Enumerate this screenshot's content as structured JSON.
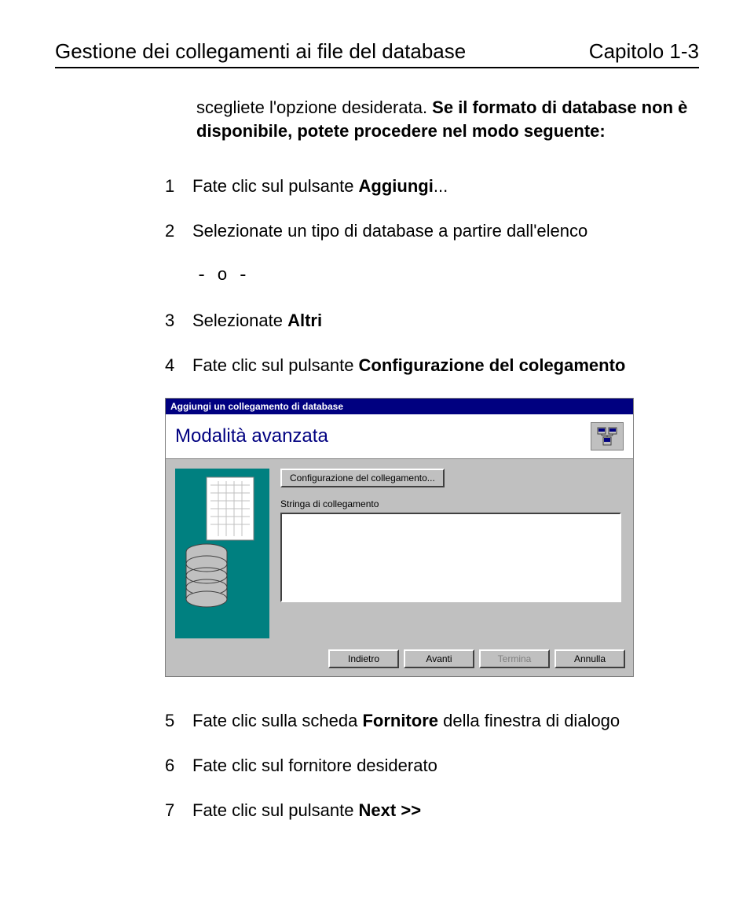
{
  "header": {
    "left": "Gestione dei collegamenti ai file del database",
    "right": "Capitolo 1-3"
  },
  "intro": {
    "pre": "scegliete l'opzione desiderata. ",
    "bold": "Se il formato di database non è disponibile, potete procedere nel modo seguente:"
  },
  "steps": {
    "s1": {
      "num": "1",
      "pre": "Fate clic sul pulsante ",
      "bold": "Aggiungi",
      "post": "..."
    },
    "or": "- o -",
    "s2": {
      "num": "2",
      "txt": "Selezionate un tipo di database a partire dall'elenco"
    },
    "s3": {
      "num": "3",
      "pre": "Selezionate ",
      "bold": "Altri"
    },
    "s4": {
      "num": "4",
      "pre": "Fate clic sul pulsante ",
      "bold": "Configurazione del colegamento"
    },
    "s5": {
      "num": "5",
      "pre": "Fate clic sulla scheda ",
      "bold": "Fornitore",
      "post": " della finestra di dialogo"
    },
    "s6": {
      "num": "6",
      "txt": "Fate clic sul fornitore desiderato"
    },
    "s7": {
      "num": "7",
      "pre": "Fate clic sul pulsante ",
      "bold": "Next >>"
    }
  },
  "dialog": {
    "title": "Aggiungi un collegamento di database",
    "banner": "Modalità avanzata",
    "cfg_button": "Configurazione del collegamento...",
    "conn_label": "Stringa di collegamento",
    "buttons": {
      "back": "Indietro",
      "next": "Avanti",
      "finish": "Termina",
      "cancel": "Annulla"
    }
  }
}
